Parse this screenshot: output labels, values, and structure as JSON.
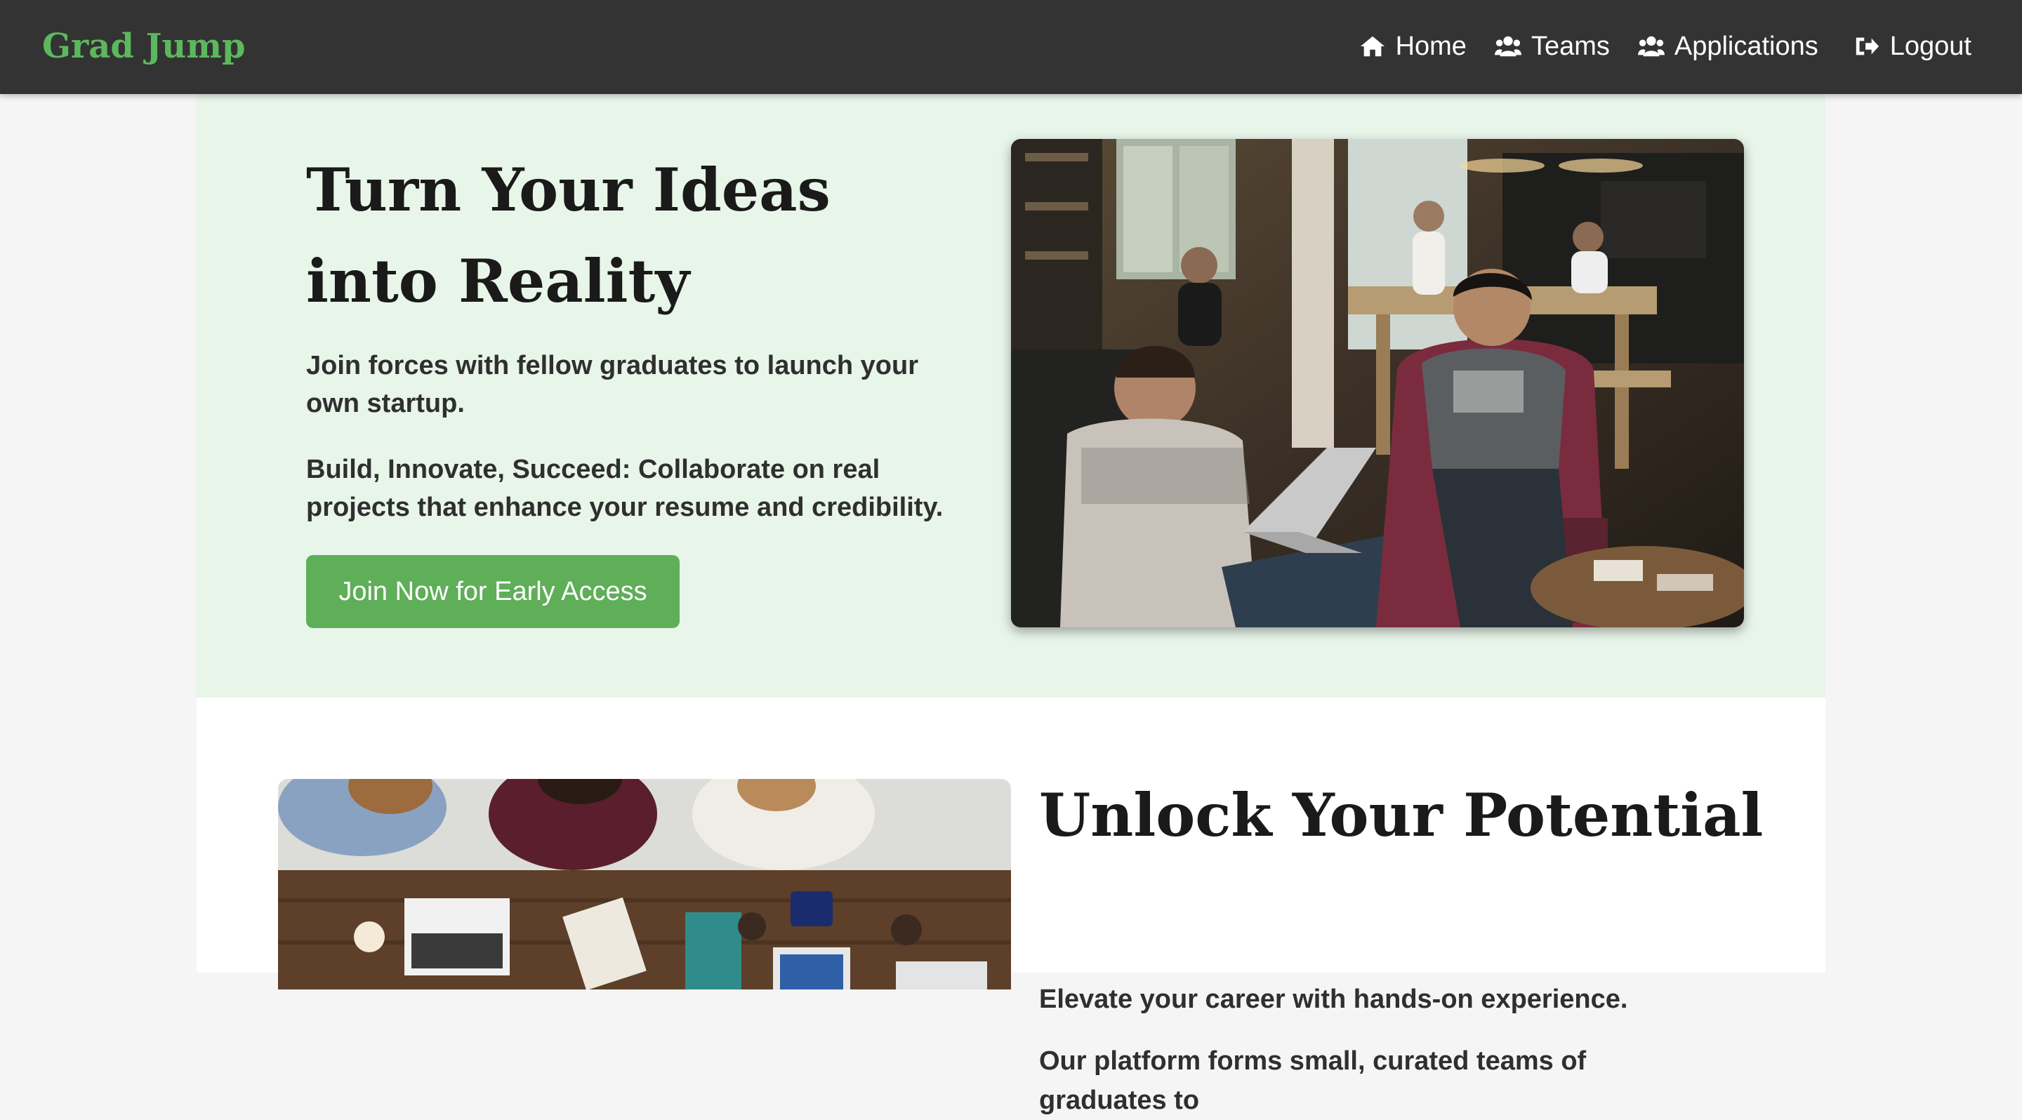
{
  "navbar": {
    "brand": "Grad Jump",
    "links": [
      {
        "label": "Home",
        "icon": "home-icon"
      },
      {
        "label": "Teams",
        "icon": "users-icon"
      },
      {
        "label": "Applications",
        "icon": "users-icon"
      },
      {
        "label": "Logout",
        "icon": "sign-out-icon"
      }
    ]
  },
  "hero": {
    "title": "Turn Your Ideas into Reality",
    "text1": "Join forces with fellow graduates to launch your own startup.",
    "text2": "Build, Innovate, Succeed: Collaborate on real projects that enhance your resume and credibility.",
    "cta_label": "Join Now for Early Access"
  },
  "section2": {
    "title": "Unlock Your Potential",
    "text1": "Elevate your career with hands-on experience.",
    "text2": "Our platform forms small, curated teams of graduates to"
  },
  "colors": {
    "navbar_bg": "#333333",
    "brand": "#5cb85c",
    "hero_bg": "#e8f5e9",
    "cta_bg": "#5fae58"
  }
}
